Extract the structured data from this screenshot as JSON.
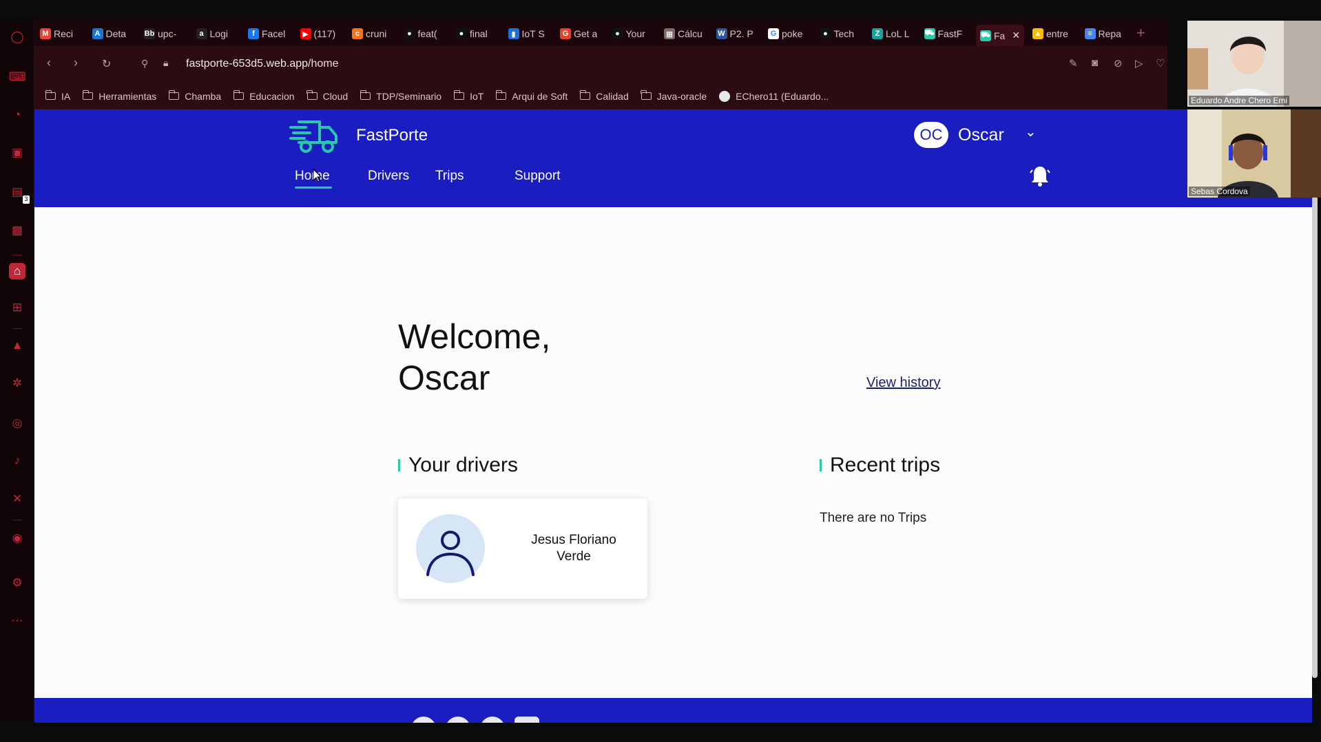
{
  "tabs": [
    {
      "label": "Reci",
      "icon": "gmail-icon",
      "color": "#ea4335",
      "glyph": "M"
    },
    {
      "label": "Deta",
      "icon": "azure-icon",
      "color": "#1976d2",
      "glyph": "A"
    },
    {
      "label": "upc-",
      "icon": "blackboard-icon",
      "color": "#222222",
      "glyph": "Bb"
    },
    {
      "label": "Logi",
      "icon": "amazon-icon",
      "color": "#222222",
      "glyph": "a"
    },
    {
      "label": "Facel",
      "icon": "facebook-icon",
      "color": "#1877f2",
      "glyph": "f"
    },
    {
      "label": "(117)",
      "icon": "youtube-icon",
      "color": "#ff0000",
      "glyph": "▶"
    },
    {
      "label": "cruni",
      "icon": "crunchyroll-icon",
      "color": "#f47521",
      "glyph": "c"
    },
    {
      "label": "feat(",
      "icon": "github-icon",
      "color": "#111111",
      "glyph": "●"
    },
    {
      "label": "final",
      "icon": "github-icon",
      "color": "#111111",
      "glyph": "●"
    },
    {
      "label": "IoT S",
      "icon": "trello-icon",
      "color": "#1e6fd9",
      "glyph": "▮"
    },
    {
      "label": "Get a",
      "icon": "gitlab-icon",
      "color": "#e24329",
      "glyph": "G"
    },
    {
      "label": "Your",
      "icon": "github-icon",
      "color": "#111111",
      "glyph": "●"
    },
    {
      "label": "Cálcu",
      "icon": "calculator-icon",
      "color": "#7a6a6a",
      "glyph": "▦"
    },
    {
      "label": "P2. P",
      "icon": "word-icon",
      "color": "#2b579a",
      "glyph": "W"
    },
    {
      "label": "poke",
      "icon": "google-icon",
      "color": "#ffffff",
      "glyph": "G"
    },
    {
      "label": "Tech",
      "icon": "github-icon",
      "color": "#111111",
      "glyph": "●"
    },
    {
      "label": "LoL L",
      "icon": "lol-icon",
      "color": "#1aa39a",
      "glyph": "Z"
    },
    {
      "label": "FastF",
      "icon": "fastporte-icon",
      "color": "#28c9a8",
      "glyph": "⛟"
    },
    {
      "label": "Fa",
      "icon": "fastporte-icon",
      "color": "#28c9a8",
      "glyph": "⛟",
      "active": true
    },
    {
      "label": "entre",
      "icon": "drive-icon",
      "color": "#fbbc04",
      "glyph": "▲"
    },
    {
      "label": "Repa",
      "icon": "docs-icon",
      "color": "#4285f4",
      "glyph": "≡"
    }
  ],
  "address": {
    "host": "fastporte-653d5.web.app",
    "path": "/home"
  },
  "bookmarks": [
    {
      "label": "IA"
    },
    {
      "label": "Herramientas"
    },
    {
      "label": "Chamba"
    },
    {
      "label": "Educacion"
    },
    {
      "label": "Cloud"
    },
    {
      "label": "TDP/Seminario"
    },
    {
      "label": "IoT"
    },
    {
      "label": "Arqui de Soft"
    },
    {
      "label": "Calidad"
    },
    {
      "label": "Java-oracle"
    },
    {
      "label": "EChero11 (Eduardo...",
      "github": true
    }
  ],
  "app": {
    "brand": "FastPorte",
    "nav": {
      "home": "Home",
      "drivers": "Drivers",
      "trips": "Trips",
      "support": "Support"
    },
    "user": {
      "initials": "OC",
      "name": "Oscar"
    },
    "accent": "#28c9a8",
    "primary": "#1a1ec0"
  },
  "main": {
    "welcome_line1": "Welcome,",
    "welcome_line2": "Oscar",
    "view_history": "View history",
    "drivers_title": "Your drivers",
    "trips_title": "Recent trips",
    "driver": {
      "name": "Jesus Floriano Verde"
    },
    "no_trips": "There are no Trips"
  },
  "video": {
    "tile1_name": "Eduardo Andre Chero Emi",
    "tile2_name": "Sebas Cordova"
  },
  "sidebar_badge": "3"
}
